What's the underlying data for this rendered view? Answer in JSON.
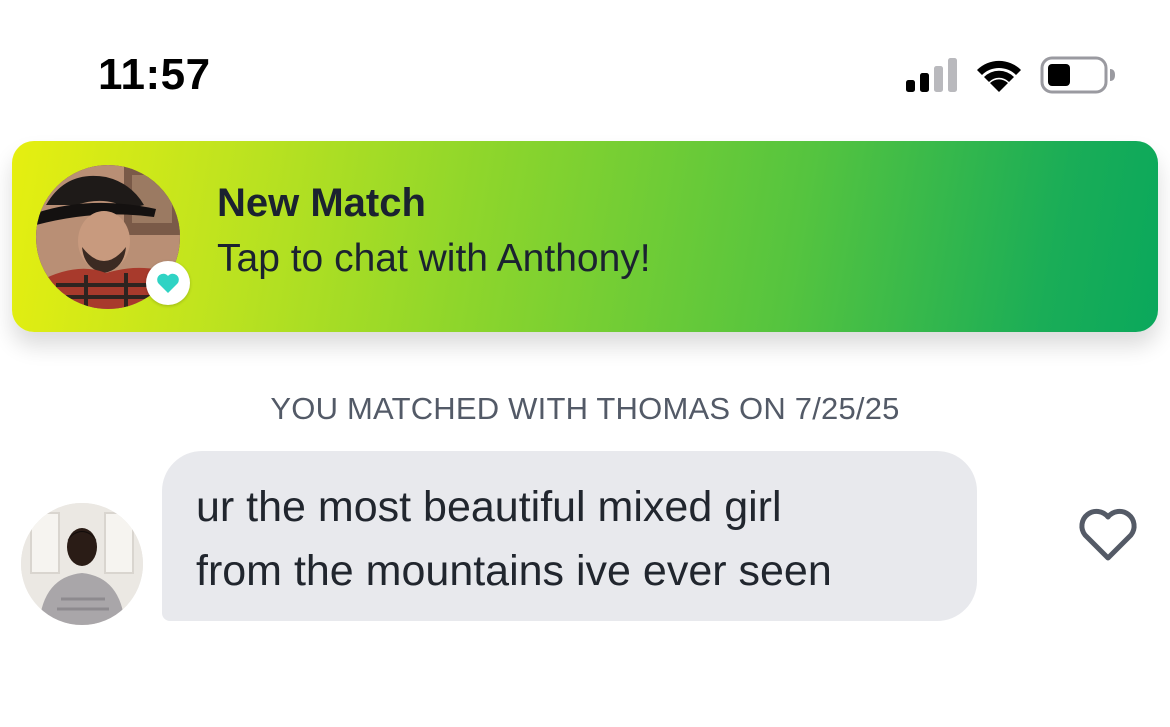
{
  "status_bar": {
    "time": "11:57",
    "signal_icon": "cellular-signal-icon",
    "wifi_icon": "wifi-icon",
    "battery_icon": "battery-icon"
  },
  "notification": {
    "title": "New Match",
    "subtitle": "Tap to chat with Anthony!",
    "badge_icon": "heart-icon",
    "gradient_colors": [
      "#e6ef10",
      "#0aa85c"
    ]
  },
  "conversation": {
    "match_info": "YOU MATCHED WITH THOMAS ON 7/25/25",
    "messages": [
      {
        "text": "ur the most beautiful mixed girl\nfrom the mountains ive ever seen",
        "like_icon": "heart-outline-icon"
      }
    ]
  },
  "colors": {
    "bubble_bg": "#e8e9ed",
    "heart_badge": "#2fd3c4",
    "text_primary": "#21262e",
    "text_secondary": "#535a67"
  }
}
